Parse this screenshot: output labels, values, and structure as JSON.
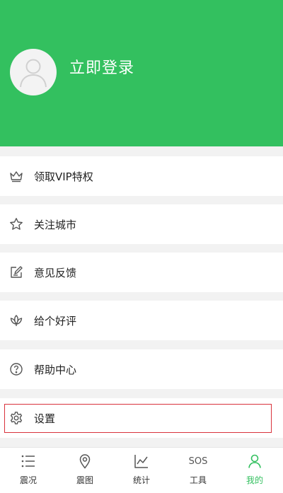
{
  "header": {
    "login_label": "立即登录",
    "accent_color": "#33c05f",
    "avatar_icon": "user-avatar-icon"
  },
  "menu": [
    {
      "label": "领取VIP特权",
      "icon": "crown-icon"
    },
    {
      "label": "关注城市",
      "icon": "star-icon"
    },
    {
      "label": "意见反馈",
      "icon": "edit-note-icon"
    },
    {
      "label": "给个好评",
      "icon": "lotus-icon"
    },
    {
      "label": "帮助中心",
      "icon": "question-circle-icon"
    },
    {
      "label": "设置",
      "icon": "gear-icon"
    }
  ],
  "tabbar": {
    "tabs": [
      {
        "label": "震况",
        "icon": "list-icon",
        "active": false
      },
      {
        "label": "震图",
        "icon": "map-pin-icon",
        "active": false
      },
      {
        "label": "统计",
        "icon": "chart-icon",
        "active": false
      },
      {
        "label": "工具",
        "icon": "sos-icon",
        "icon_text": "SOS",
        "active": false
      },
      {
        "label": "我的",
        "icon": "person-icon",
        "active": true
      }
    ]
  }
}
